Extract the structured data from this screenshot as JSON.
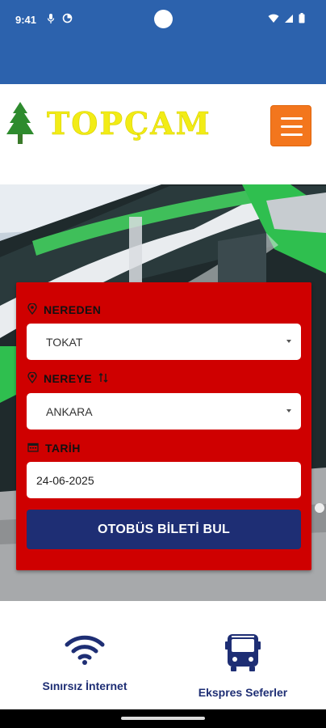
{
  "status_bar": {
    "time": "9:41",
    "icons_left": [
      "mic-icon",
      "data-saver-icon"
    ],
    "icons_right": [
      "wifi-icon",
      "signal-icon",
      "battery-icon"
    ],
    "color": "#2c62ad"
  },
  "header": {
    "brand": "TOPÇAM",
    "logo_icon": "pine-tree-icon",
    "menu_icon": "hamburger-icon",
    "brand_color": "#f2ec16",
    "menu_color": "#f3761d"
  },
  "search": {
    "from_label": "NEREDEN",
    "from_value": "TOKAT",
    "to_label": "NEREYE",
    "to_value": "ANKARA",
    "swap_icon": "swap-arrows-icon",
    "date_label": "TARİH",
    "date_value": "24-06-2025",
    "submit_label": "OTOBÜS BİLETİ BUL",
    "panel_color": "#cf0000",
    "button_color": "#1e2e74"
  },
  "features": [
    {
      "label": "Sınırsız İnternet",
      "icon": "wifi-icon"
    },
    {
      "label": "Ekspres Seferler",
      "icon": "bus-icon"
    }
  ]
}
